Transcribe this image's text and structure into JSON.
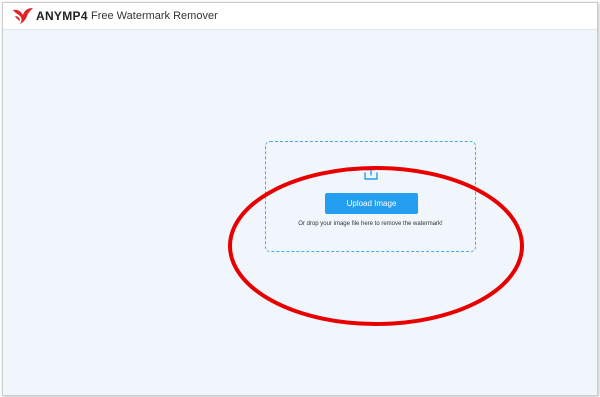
{
  "header": {
    "brand_name": "ANYMP4",
    "app_title": "Free Watermark Remover",
    "logo_icon": "bird-logo-icon"
  },
  "upload": {
    "icon": "upload-icon",
    "button_label": "Upload Image",
    "hint": "Or drop your image file here to remove the watermark!"
  },
  "colors": {
    "accent": "#239ef0",
    "dashed_border": "#4aa7e3",
    "background": "#f1f6fd",
    "logo": "#e02424",
    "annotation": "#e80000"
  }
}
